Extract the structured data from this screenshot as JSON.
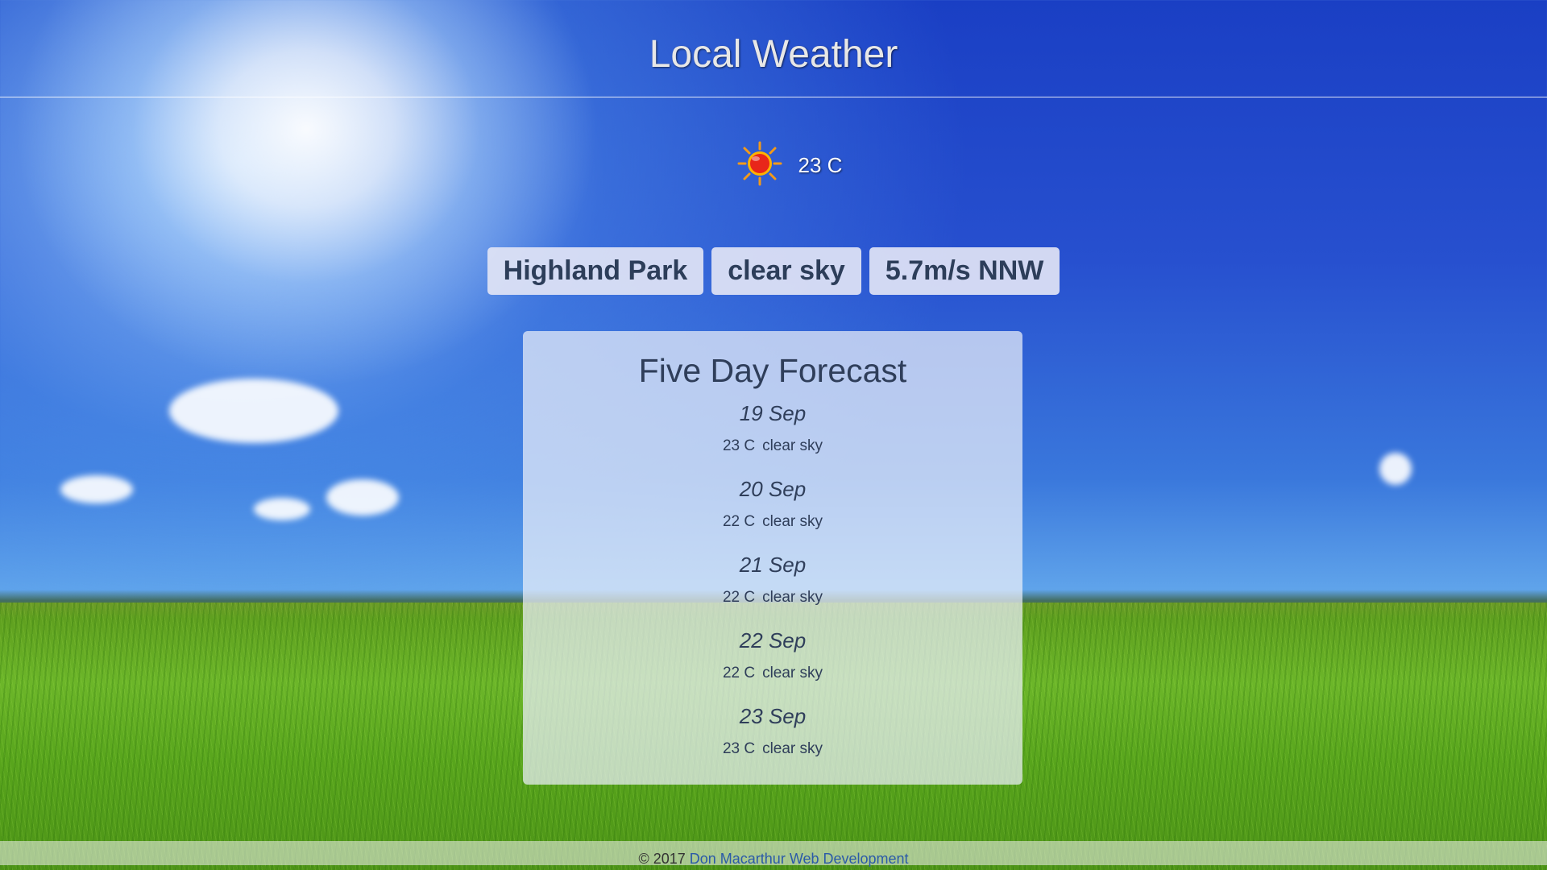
{
  "header": {
    "title": "Local Weather"
  },
  "current": {
    "icon": "sun-icon",
    "temperature": "23 C",
    "location": "Highland Park",
    "condition": "clear sky",
    "wind": "5.7m/s NNW"
  },
  "forecast": {
    "title": "Five Day Forecast",
    "days": [
      {
        "date": "19 Sep",
        "temp": "23 C",
        "condition": "clear sky"
      },
      {
        "date": "20 Sep",
        "temp": "22 C",
        "condition": "clear sky"
      },
      {
        "date": "21 Sep",
        "temp": "22 C",
        "condition": "clear sky"
      },
      {
        "date": "22 Sep",
        "temp": "22 C",
        "condition": "clear sky"
      },
      {
        "date": "23 Sep",
        "temp": "23 C",
        "condition": "clear sky"
      }
    ]
  },
  "footer": {
    "copyright": "© 2017",
    "link_text": "Don Macarthur Web Development"
  },
  "colors": {
    "sky_top": "#1a3fc4",
    "grass": "#6cb629",
    "panel_text": "#2f3e5a",
    "footer_link": "#2b5aa8"
  }
}
